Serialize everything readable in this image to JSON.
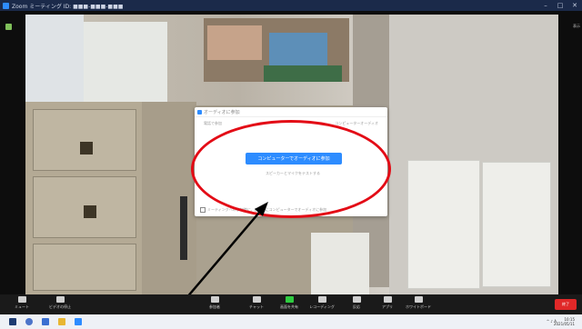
{
  "window": {
    "title": "Zoom ミーティング ID: ■■■-■■■-■■■",
    "minimize": "–",
    "maximize": "□",
    "close": "✕"
  },
  "meeting": {
    "view_label": "表示"
  },
  "dialog": {
    "title": "オーディオに参加",
    "tab_left": "電話で参加",
    "tab_right": "コンピューターオーディオ",
    "join_button": "コンピューターでオーディオに参加",
    "test_link": "スピーカーとマイクをテストする",
    "footer_checkbox_label": "ミーティングへの参加時に、自動的にコンピューターでオーディオに参加"
  },
  "toolbar": {
    "buttons": [
      {
        "icon": "microphone-icon",
        "label": "ミュート"
      },
      {
        "icon": "video-camera-icon",
        "label": "ビデオの停止"
      },
      {
        "icon": "participants-icon",
        "label": "参加者"
      },
      {
        "icon": "chat-icon",
        "label": "チャット"
      },
      {
        "icon": "share-screen-icon",
        "label": "画面を共有"
      },
      {
        "icon": "record-icon",
        "label": "レコーディング"
      },
      {
        "icon": "reactions-icon",
        "label": "反応"
      },
      {
        "icon": "apps-icon",
        "label": "アプリ"
      },
      {
        "icon": "whiteboard-icon",
        "label": "ホワイトボード"
      }
    ],
    "end_button": "終了"
  },
  "taskbar": {
    "icons": [
      "windows-start-icon",
      "search-icon",
      "task-view-icon",
      "file-explorer-icon",
      "zoom-app-icon"
    ],
    "tray_text": "^ ♪ A",
    "clock_time": "10:15",
    "clock_date": "2021/05/11"
  },
  "colors": {
    "accent": "#2d8cff",
    "highlight": "#e30c16",
    "end": "#e02828"
  }
}
